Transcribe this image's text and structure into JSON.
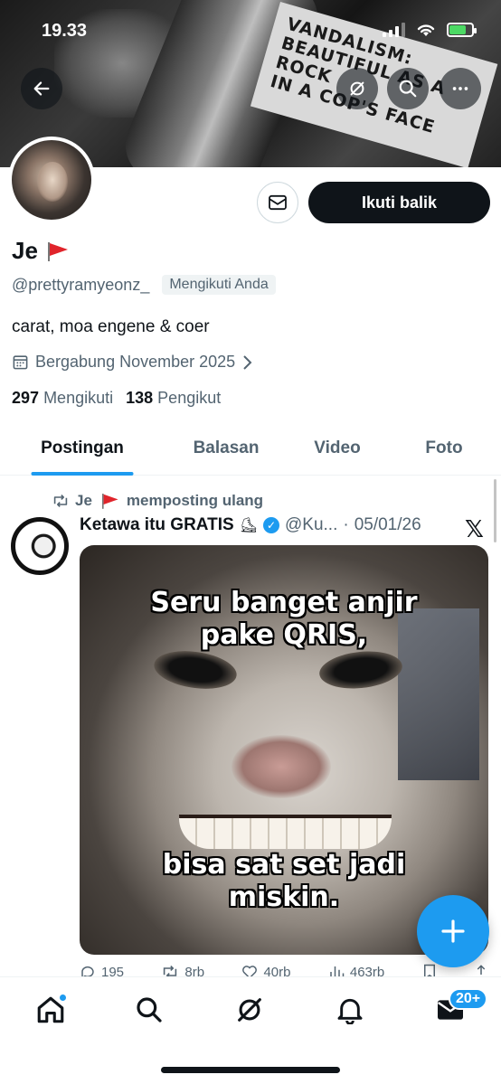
{
  "status_bar": {
    "time": "19.33"
  },
  "banner": {
    "sign_line1": "VANDALISM:",
    "sign_line2": "BEAUTIFUL AS A ROCK",
    "sign_line3": "IN A COP'S FACE"
  },
  "profile": {
    "name": "Je",
    "handle": "@prettyramyeonz_",
    "follows_you": "Mengikuti Anda",
    "bio": "carat, moa engene & coer",
    "joined": "Bergabung November 2025",
    "following_count": "297",
    "following_label": "Mengikuti",
    "followers_count": "138",
    "followers_label": "Pengikut",
    "follow_back_label": "Ikuti balik"
  },
  "tabs": [
    {
      "label": "Postingan",
      "active": true
    },
    {
      "label": "Balasan",
      "active": false
    },
    {
      "label": "Video",
      "active": false
    },
    {
      "label": "Foto",
      "active": false
    }
  ],
  "post": {
    "repost_by": "Je",
    "repost_label": "memposting ulang",
    "author": "Ketawa itu GRATIS",
    "handle": "@Ku...",
    "date": "05/01/26",
    "meme_top_1": "Seru banget anjir",
    "meme_top_2": "pake QRIS,",
    "meme_bottom_1": "bisa sat set jadi",
    "meme_bottom_2": "miskin.",
    "replies": "195",
    "reposts": "8rb",
    "likes": "40rb",
    "views": "463rb"
  },
  "nav": {
    "messages_badge": "20+"
  },
  "colors": {
    "accent": "#1d9bf0",
    "text": "#0f1419",
    "muted": "#536471",
    "flag": "#e0242b"
  },
  "icons": [
    "back-arrow-icon",
    "grok-icon",
    "search-icon",
    "more-icon",
    "mail-icon",
    "calendar-icon",
    "chevron-right-icon",
    "repost-icon",
    "verified-icon",
    "x-logo-icon",
    "reply-icon",
    "like-icon",
    "views-icon",
    "share-icon",
    "plus-icon",
    "home-icon",
    "bell-icon",
    "envelope-icon"
  ]
}
